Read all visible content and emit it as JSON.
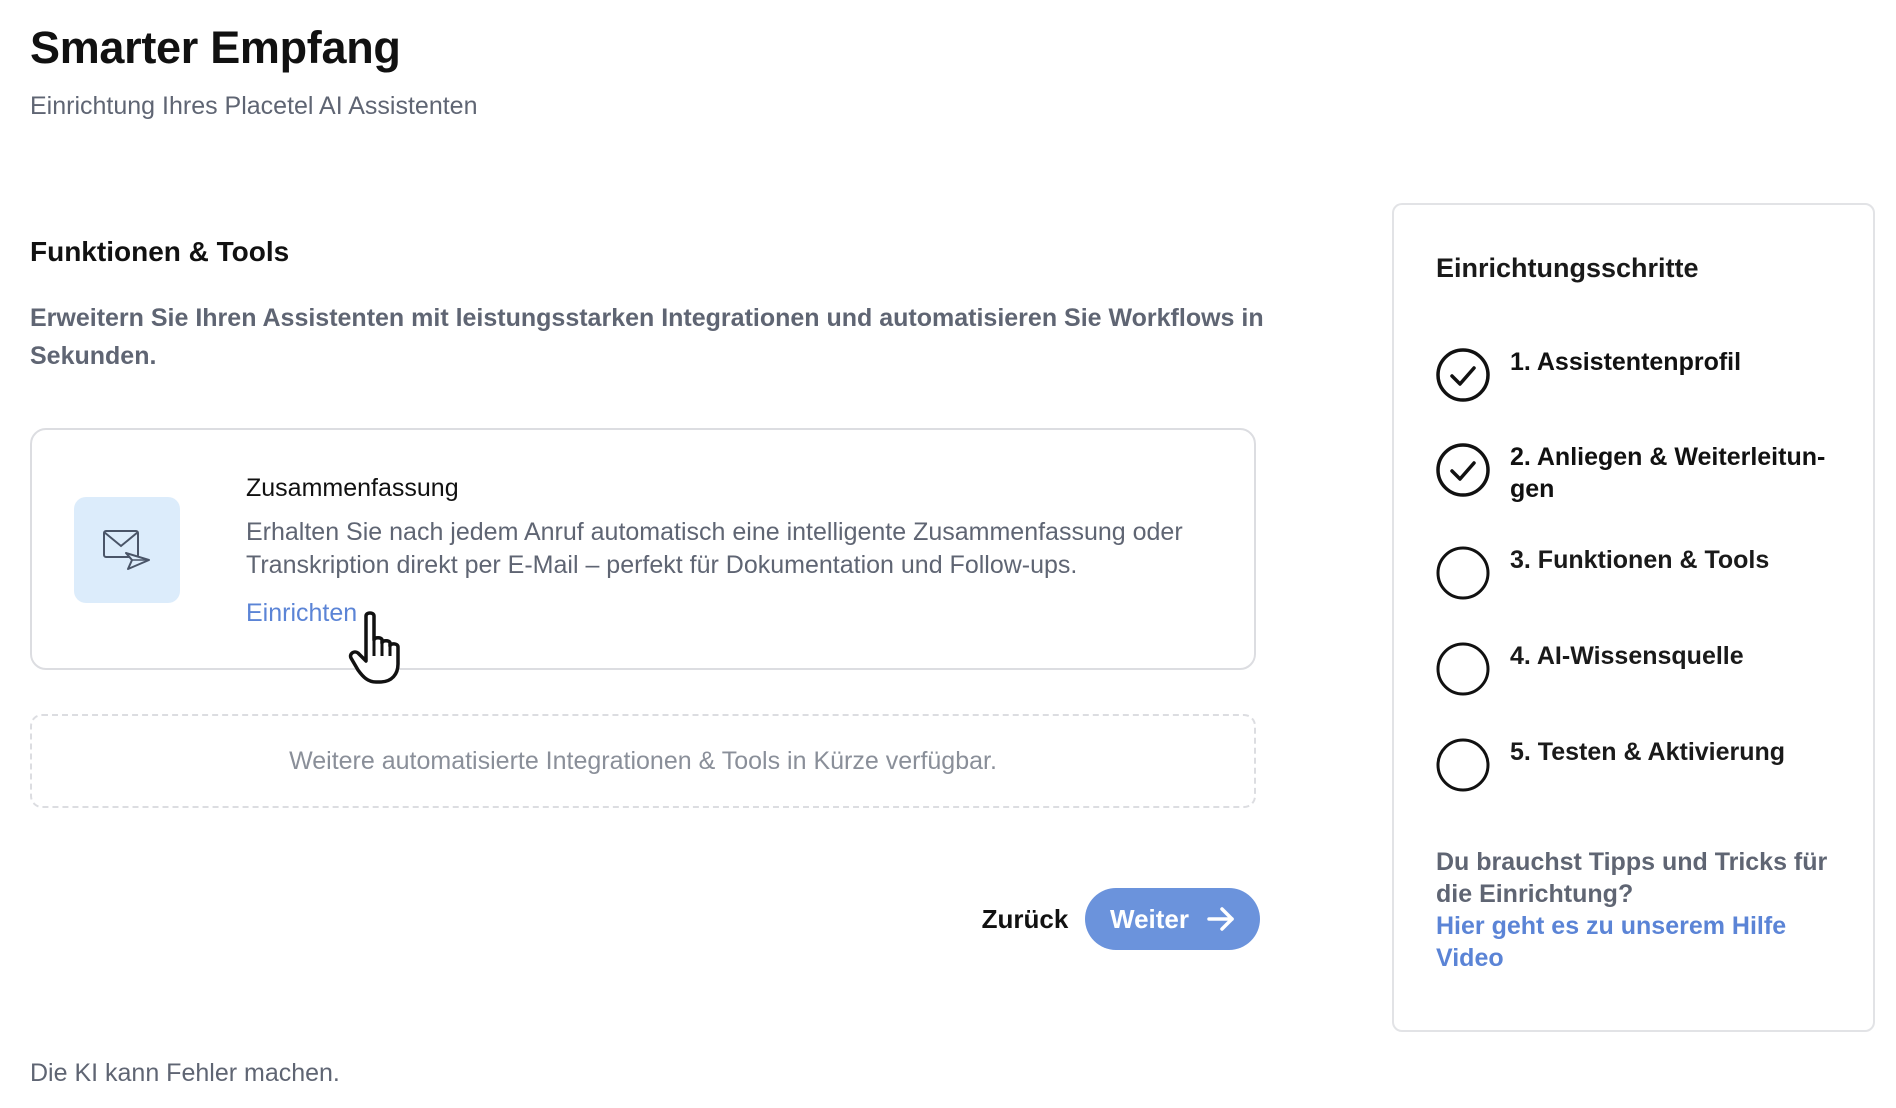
{
  "header": {
    "title": "Smarter Empfang",
    "subtitle": "Einrichtung Ihres Placetel AI Assistenten"
  },
  "section": {
    "title": "Funktionen & Tools",
    "description": "Erweitern Sie Ihren Assistenten mit leistungsstarken Integrationen und automatisieren Sie Workflows in Sekunden."
  },
  "feature_card": {
    "icon": "mail-send-icon",
    "name": "Zusammenfassung",
    "description": "Erhalten Sie nach jedem Anruf automatisch eine intelligente Zusammenfassung oder Transkription direkt per E-Mail – perfekt für Dokumentation und Follow-ups.",
    "link_label": "Einrichten"
  },
  "coming_soon": {
    "text": "Weitere automatisierte Integrationen & Tools in Kürze verfügbar."
  },
  "navigation": {
    "back_label": "Zurück",
    "next_label": "Weiter",
    "next_icon": "arrow-right-icon"
  },
  "footer": {
    "disclaimer": "Die KI kann Fehler machen."
  },
  "steps_panel": {
    "title": "Einrichtungsschritte",
    "steps": [
      {
        "label": "1. Assistentenprofil",
        "completed": true
      },
      {
        "label": "2. Anliegen & Weiterleitungen",
        "label_display": "2. Anliegen & Weiterleitun-gen",
        "completed": true
      },
      {
        "label": "3. Funktionen & Tools",
        "completed": false
      },
      {
        "label": "4. AI-Wissensquelle",
        "completed": false
      },
      {
        "label": "5. Testen & Aktivierung",
        "completed": false
      }
    ],
    "help_text": "Du brauchst Tipps und Tricks für die Einrichtung?",
    "help_link": "Hier geht es zu unserem Hilfe Video"
  },
  "colors": {
    "accent": "#6b93dc",
    "link": "#5b84d6",
    "icon_bg": "#dcecfb",
    "muted_text": "#5f6573",
    "border": "#dcdde1"
  }
}
